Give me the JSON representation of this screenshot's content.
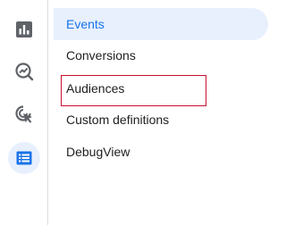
{
  "rail": {
    "icons": [
      {
        "name": "reports-icon"
      },
      {
        "name": "explore-icon"
      },
      {
        "name": "advertising-icon"
      },
      {
        "name": "configure-icon",
        "active": true
      }
    ],
    "accent": "#1a73e8",
    "icon_color": "#5f6368"
  },
  "nav": {
    "items": [
      {
        "label": "Events",
        "selected": true
      },
      {
        "label": "Conversions"
      },
      {
        "label": "Audiences",
        "highlighted": true
      },
      {
        "label": "Custom definitions"
      },
      {
        "label": "DebugView"
      }
    ],
    "selected_bg": "#e8f0fe",
    "highlight_color": "#c8102e"
  }
}
